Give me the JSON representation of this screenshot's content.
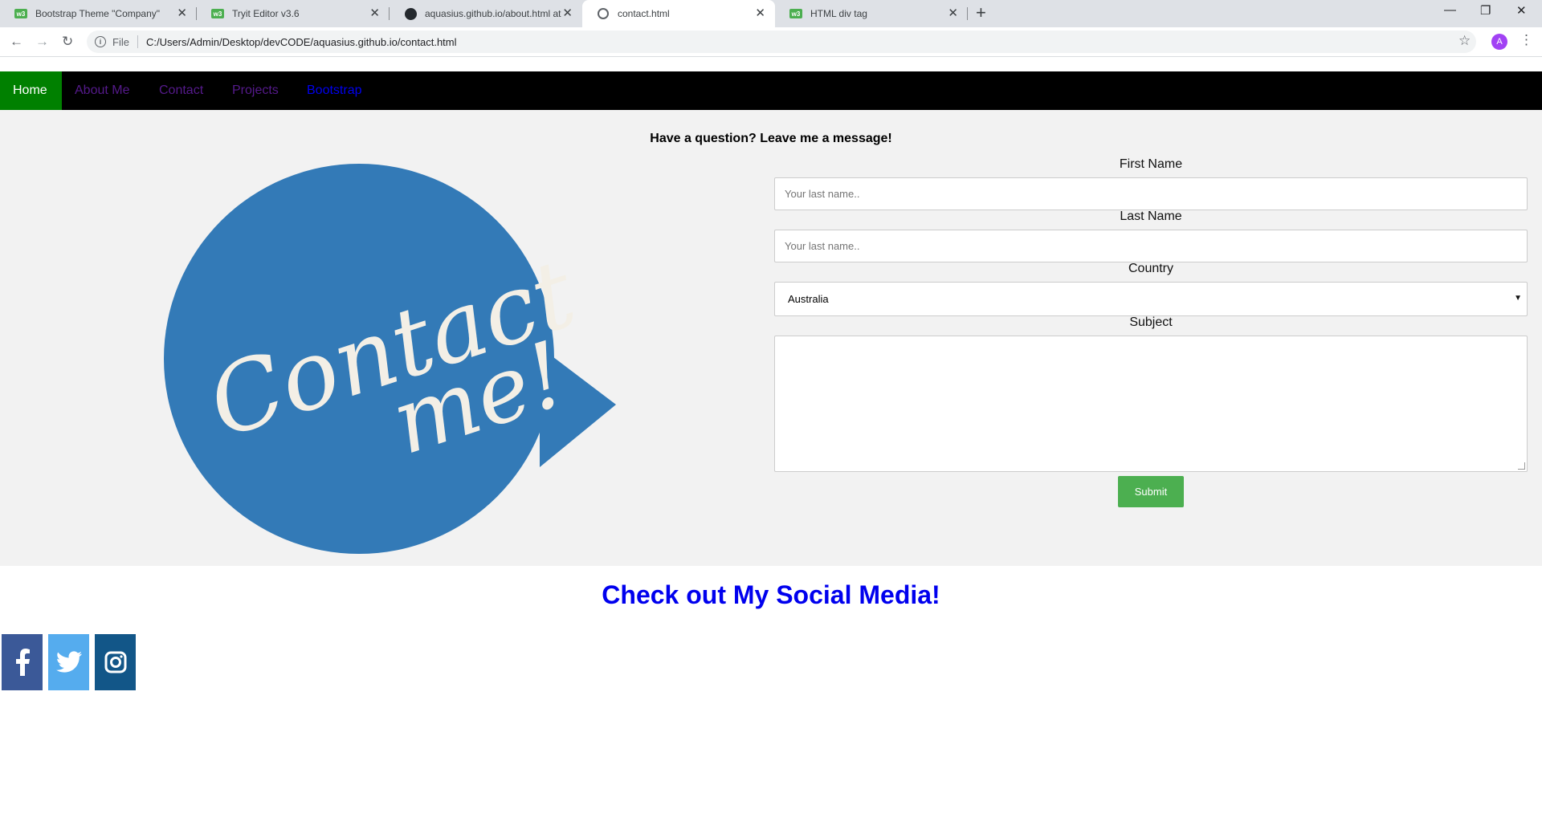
{
  "browser": {
    "tabs": [
      {
        "title": "Bootstrap Theme \"Company\"",
        "icon": "w3schools-icon",
        "active": false
      },
      {
        "title": "Tryit Editor v3.6",
        "icon": "w3schools-icon",
        "active": false
      },
      {
        "title": "aquasius.github.io/about.html at",
        "icon": "github-icon",
        "active": false
      },
      {
        "title": "contact.html",
        "icon": "globe-icon",
        "active": true
      },
      {
        "title": "HTML div tag",
        "icon": "w3schools-icon",
        "active": false
      }
    ],
    "close_glyph": "✕",
    "new_tab_glyph": "+",
    "window_controls": {
      "minimize": "—",
      "restore": "❐",
      "close": "✕"
    },
    "nav": {
      "back": "←",
      "forward": "→",
      "reload": "↻"
    },
    "address": {
      "info_glyph": "i",
      "scheme_label": "File",
      "url": "C:/Users/Admin/Desktop/devCODE/aquasius.github.io/contact.html"
    },
    "star_glyph": "☆",
    "profile_initial": "A",
    "menu_glyph": "⋮"
  },
  "navbar": {
    "items": [
      {
        "label": "Home",
        "active": true,
        "color": "#ffffff",
        "bg": "#008000"
      },
      {
        "label": "About Me",
        "active": false,
        "color": "#551a8b"
      },
      {
        "label": "Contact",
        "active": false,
        "color": "#551a8b"
      },
      {
        "label": "Projects",
        "active": false,
        "color": "#551a8b"
      },
      {
        "label": "Bootstrap",
        "active": false,
        "color": "#0000ee"
      }
    ]
  },
  "main": {
    "question": "Have a question? Leave me a message!",
    "logo": {
      "line1": "Contact",
      "line2": "me!",
      "bubble_color": "#337ab7",
      "text_color": "#f3efe6"
    },
    "form": {
      "first_name_label": "First Name",
      "first_name_placeholder": "Your last name..",
      "last_name_label": "Last Name",
      "last_name_placeholder": "Your last name..",
      "country_label": "Country",
      "country_value": "Australia",
      "country_arrow": "▼",
      "subject_label": "Subject",
      "submit_label": "Submit"
    }
  },
  "social": {
    "heading": "Check out My Social Media!",
    "links": [
      {
        "name": "facebook",
        "icon": "facebook-icon",
        "color": "#3b5998"
      },
      {
        "name": "twitter",
        "icon": "twitter-icon",
        "color": "#55acee"
      },
      {
        "name": "instagram",
        "icon": "instagram-icon",
        "color": "#125688"
      }
    ]
  }
}
